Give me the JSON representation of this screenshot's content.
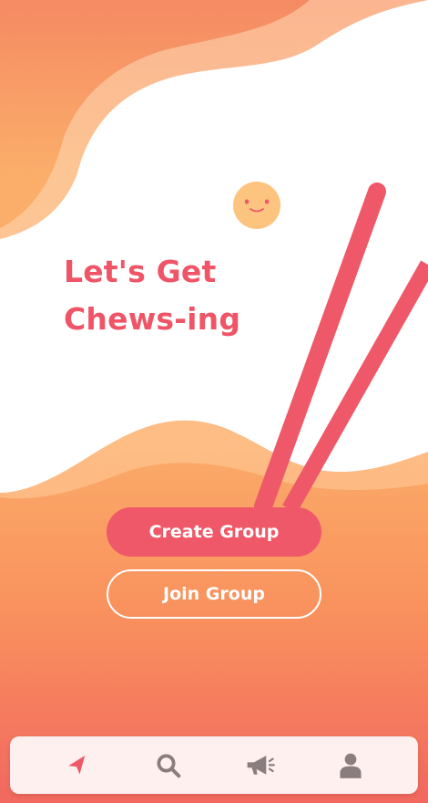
{
  "hero": {
    "headline_line1": "Let's Get",
    "headline_line2": "Chews-ing"
  },
  "actions": {
    "create_label": "Create Group",
    "join_label": "Join Group"
  },
  "tabbar": {
    "items": [
      {
        "icon": "navigation-arrow-icon",
        "active": true
      },
      {
        "icon": "search-icon",
        "active": false
      },
      {
        "icon": "megaphone-icon",
        "active": false
      },
      {
        "icon": "user-icon",
        "active": false
      }
    ]
  },
  "colors": {
    "accent": "#ef5868",
    "icon_inactive": "#8a7d7d",
    "tabbar_bg": "#fdf0ee",
    "white": "#ffffff"
  }
}
